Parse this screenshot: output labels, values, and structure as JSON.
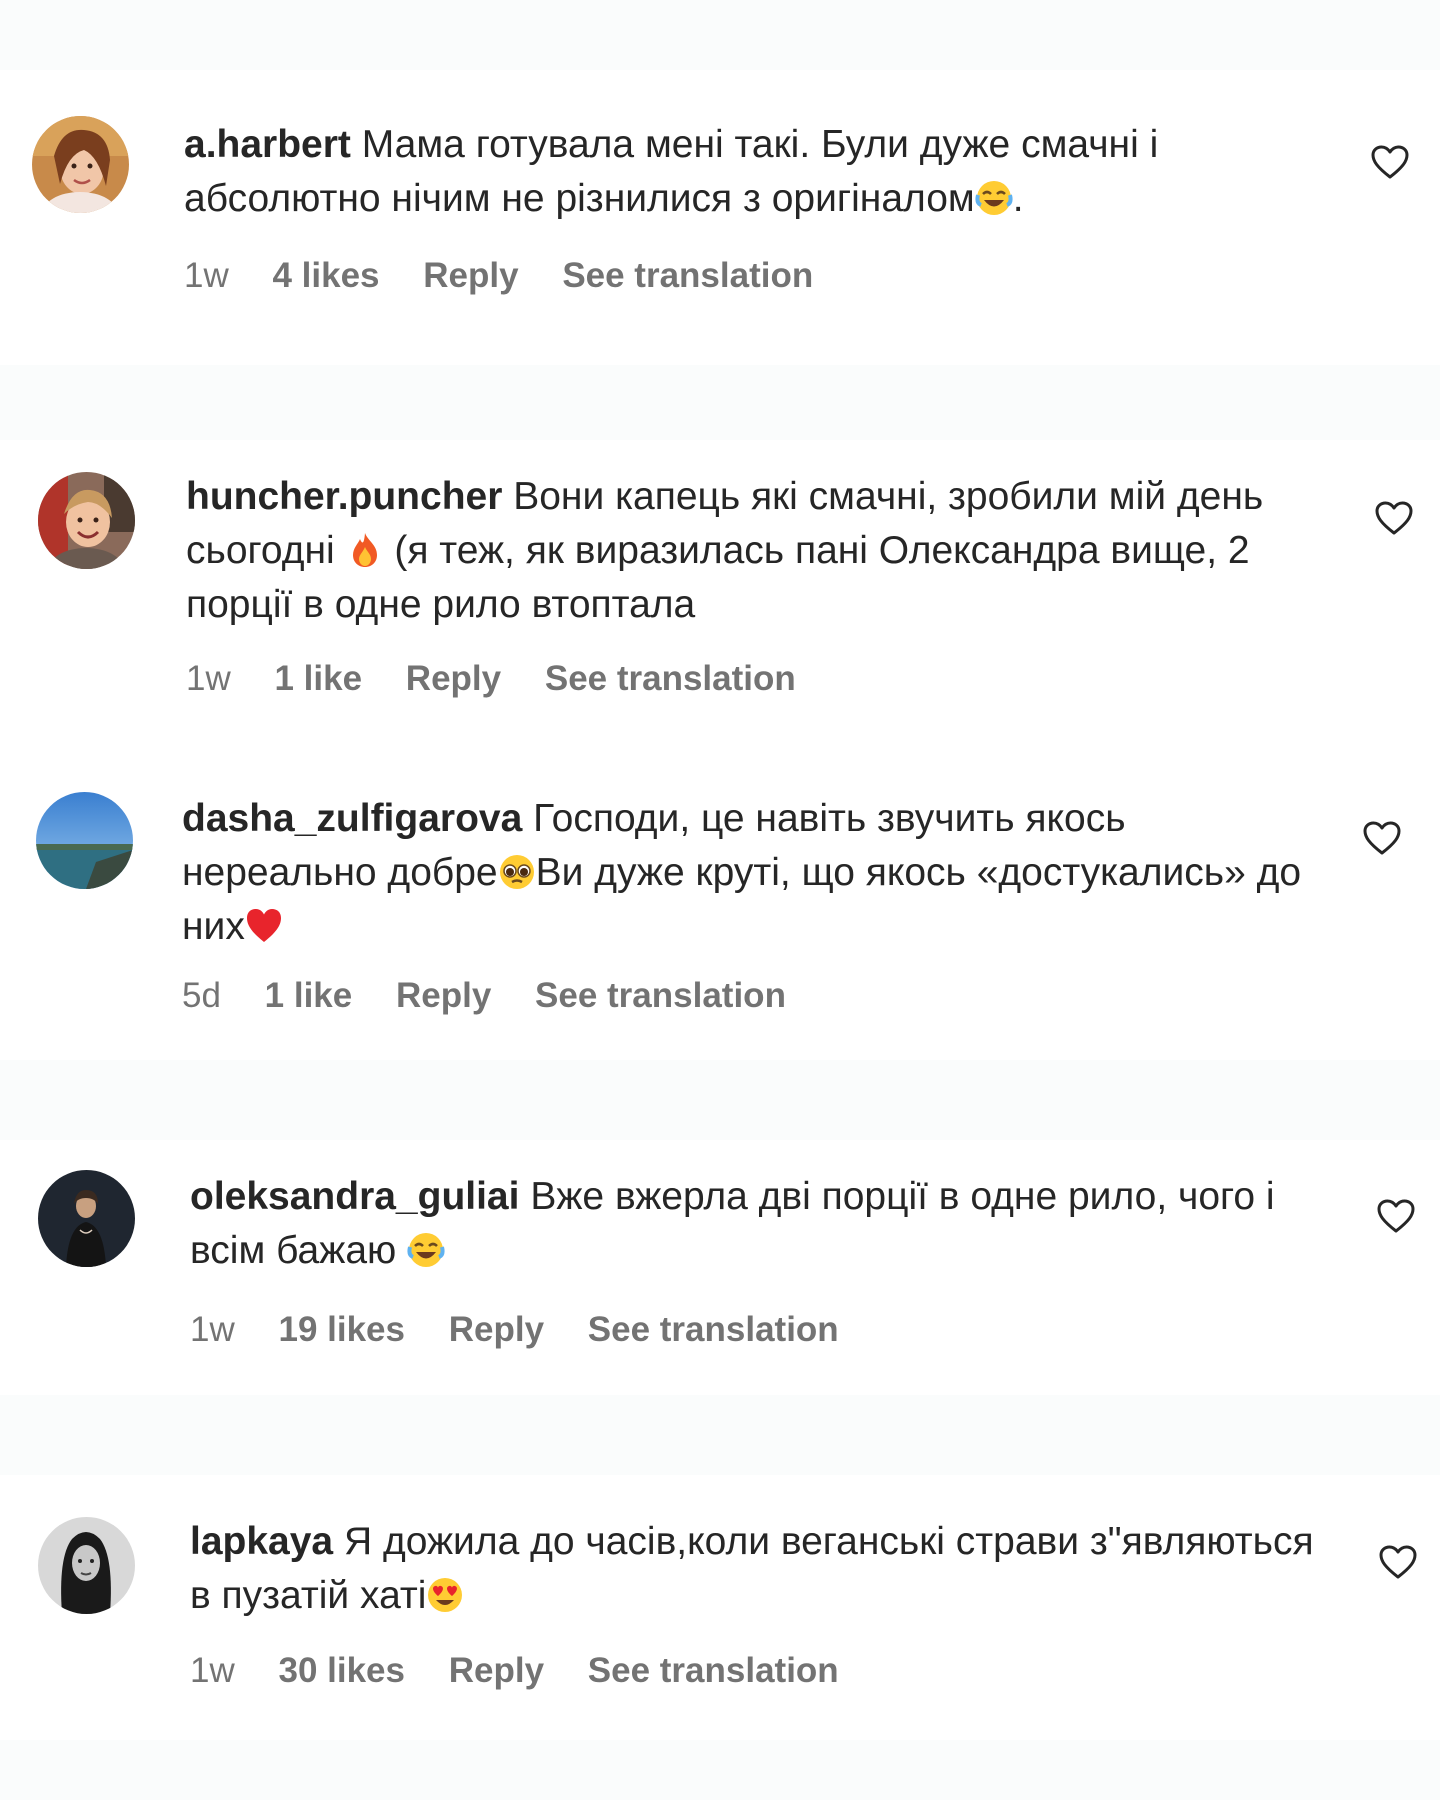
{
  "comments": [
    {
      "username": "a.harbert",
      "text_before": "Мама готувала мені такі. Були дуже смачні і абсолютно нічим не різнилися з оригіналом",
      "emoji": "face-with-tears-of-joy-icon",
      "text_after": ".",
      "time": "1w",
      "likes": "4 likes",
      "reply": "Reply",
      "translation": "See translation"
    },
    {
      "username": "huncher.puncher",
      "text_before": "Вони капець які смачні, зробили мій день сьогодні ",
      "emoji": "fire-icon",
      "text_after": " (я теж, як виразилась пані Олександра вище, 2 порції в одне рило втоптала",
      "time": "1w",
      "likes": "1 like",
      "reply": "Reply",
      "translation": "See translation"
    },
    {
      "username": "dasha_zulfigarova",
      "text_before": "Господи, це навіть звучить якось нереально добре",
      "emoji": "pleading-face-icon",
      "text_middle": "Ви дуже круті, що якось «достукались» до них",
      "emoji2": "red-heart-icon",
      "text_after": "",
      "time": "5d",
      "likes": "1 like",
      "reply": "Reply",
      "translation": "See translation"
    },
    {
      "username": "oleksandra_guliai",
      "text_before": "Вже вжерла дві порції в одне рило, чого і всім бажаю ",
      "emoji": "face-with-tears-of-joy-icon",
      "text_after": "",
      "time": "1w",
      "likes": "19 likes",
      "reply": "Reply",
      "translation": "See translation"
    },
    {
      "username": "lapkaya",
      "text_before": "Я дожила до часів,коли веганські страви з\"являються в пузатій хаті",
      "emoji": "smiling-face-with-heart-eyes-icon",
      "text_after": "",
      "time": "1w",
      "likes": "30 likes",
      "reply": "Reply",
      "translation": "See translation"
    }
  ],
  "colors": {
    "text": "#262626",
    "secondary": "#737373",
    "band": "#fafcfc"
  }
}
